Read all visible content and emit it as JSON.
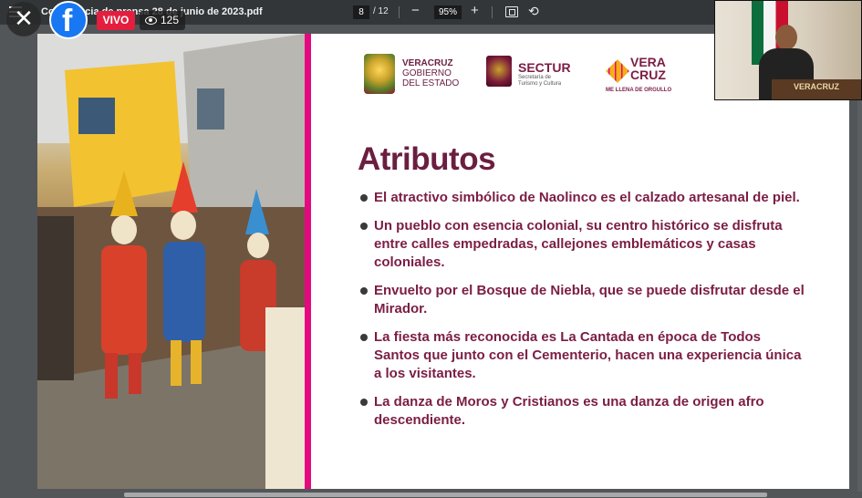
{
  "toolbar": {
    "document_title": "Conferencia de prensa 28 de junio de 2023.pdf",
    "current_page": "8",
    "page_separator": "/ 12",
    "zoom": "95%",
    "zoom_out": "−",
    "zoom_in": "+",
    "rotate": "⟲"
  },
  "overlay": {
    "close": "✕",
    "facebook": "f",
    "live_label": "VIVO",
    "viewer_count": "125"
  },
  "slide": {
    "logos": [
      {
        "line1": "VERACRUZ",
        "line2": "GOBIERNO",
        "line3": "DEL ESTADO"
      },
      {
        "line1": "SECTUR",
        "line2": "Secretaría de",
        "line3": "Turismo y Cultura"
      },
      {
        "line1": "VERA",
        "line2": "CRUZ",
        "line3": "ME LLENA DE ORGULLO"
      }
    ],
    "title": "Atributos",
    "bullets": [
      "El atractivo simbólico de Naolinco es el calzado artesanal de piel.",
      "Un pueblo con esencia colonial, su centro histórico se disfruta entre calles empedradas, callejones emblemáticos y casas coloniales.",
      "Envuelto por el Bosque de Niebla, que se puede disfrutar desde el Mirador.",
      "La fiesta más reconocida es La Cantada en época de Todos Santos que junto con el Cementerio, hacen una experiencia única  a los visitantes.",
      "La danza de Moros y Cristianos es una danza de origen afro descendiente."
    ]
  },
  "webcam": {
    "podium_text": "VERACRUZ"
  },
  "colors": {
    "accent_magenta": "#e5097f",
    "title_color": "#6b1e40",
    "facebook_blue": "#1877f2",
    "live_red": "#e41e3f",
    "toolbar": "#323639"
  }
}
